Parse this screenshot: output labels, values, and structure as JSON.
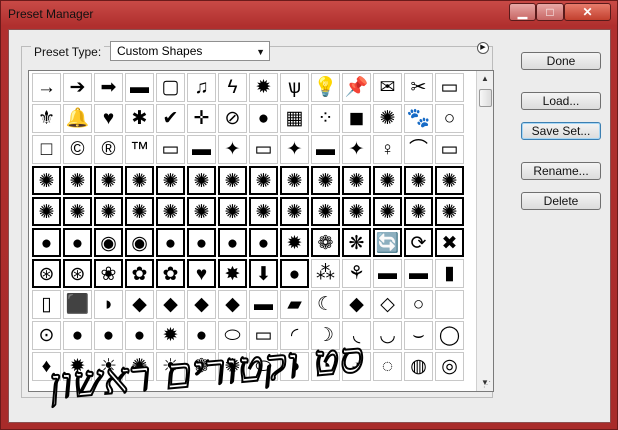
{
  "window": {
    "title": "Preset Manager",
    "min_glyph": "▁",
    "max_glyph": "□",
    "close_glyph": "✕"
  },
  "preset_type": {
    "label": "Preset Type:",
    "value": "Custom Shapes"
  },
  "buttons": {
    "done": "Done",
    "load": "Load...",
    "save_set": "Save Set...",
    "rename": "Rename...",
    "delete": "Delete"
  },
  "overlay_text": "סט וקטורים ראשון",
  "shape_rows": [
    [
      "→",
      "➔",
      "➡",
      "▬",
      "▢",
      "♫",
      "ϟ",
      "✹",
      "ѱ",
      "💡",
      "📌",
      "✉",
      "✂",
      "▭"
    ],
    [
      "⚜",
      "🔔",
      "♥",
      "✱",
      "✔",
      "✛",
      "⊘",
      "●",
      "▦",
      "⁘",
      "◼",
      "✺",
      "🐾",
      "○"
    ],
    [
      "□",
      "©",
      "®",
      "™",
      "▭",
      "▬",
      "✦",
      "▭",
      "✦",
      "▬",
      "✦",
      "♀",
      "⌒",
      "▭"
    ],
    [
      "✺",
      "✺",
      "✺",
      "✺",
      "✺",
      "✺",
      "✺",
      "✺",
      "✺",
      "✺",
      "✺",
      "✺",
      "✺",
      "✺"
    ],
    [
      "✺",
      "✺",
      "✺",
      "✺",
      "✺",
      "✺",
      "✺",
      "✺",
      "✺",
      "✺",
      "✺",
      "✺",
      "✺",
      "✺"
    ],
    [
      "●",
      "●",
      "◉",
      "◉",
      "●",
      "●",
      "●",
      "●",
      "✹",
      "❁",
      "❋",
      "🔄",
      "⟳",
      "✖"
    ],
    [
      "⊛",
      "⊛",
      "❀",
      "✿",
      "✿",
      "♥",
      "✸",
      "⬇",
      "●",
      "⁂",
      "⚘",
      "▬",
      "▬",
      "▮"
    ],
    [
      "▯",
      "⬛",
      "◗",
      "◆",
      "◆",
      "◆",
      "◆",
      "▬",
      "▰",
      "☾",
      "◆",
      "◇",
      "○",
      ""
    ],
    [
      "⊙",
      "●",
      "●",
      "●",
      "✹",
      "●",
      "⬭",
      "▭",
      "◜",
      "☽",
      "◟",
      "◡",
      "⌣",
      "◯"
    ],
    [
      "♦",
      "✹",
      "☀",
      "✺",
      "☀",
      "❁",
      "✺",
      "⬭",
      "◑",
      "◔",
      "◕",
      "◌",
      "◍",
      "◎"
    ]
  ]
}
